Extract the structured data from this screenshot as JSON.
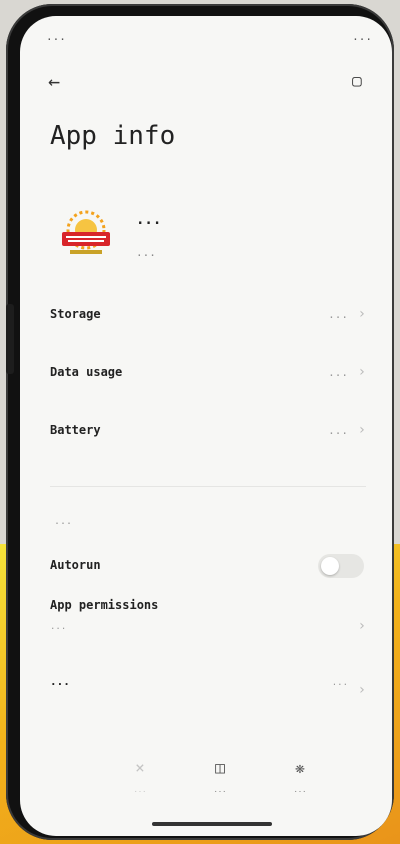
{
  "status_bar": {
    "left_text": "...",
    "right_text": "..."
  },
  "header": {
    "back_icon": "back-arrow-icon",
    "title": "App info",
    "more_icon": "more-icon"
  },
  "app": {
    "name": "...",
    "version": "..."
  },
  "rows": [
    {
      "label": "Storage",
      "value": "..."
    },
    {
      "label": "Data usage",
      "value": "..."
    },
    {
      "label": "Battery",
      "value": "..."
    }
  ],
  "section": {
    "label": "..."
  },
  "autorun": {
    "label": "Autorun",
    "enabled": false
  },
  "permissions": {
    "label": "App permissions",
    "description": "..."
  },
  "open_by_default": {
    "label": "...",
    "value": "..."
  },
  "actions": [
    {
      "label": "...",
      "icon": "uninstall-icon",
      "enabled": false
    },
    {
      "label": "...",
      "icon": "clear-data-icon",
      "enabled": true
    },
    {
      "label": "...",
      "icon": "force-stop-icon",
      "enabled": true
    }
  ],
  "colors": {
    "screen_bg": "#f7f7f5",
    "accent_yellow": "#f2b21b",
    "toggle_off": "#e6e6e3"
  }
}
